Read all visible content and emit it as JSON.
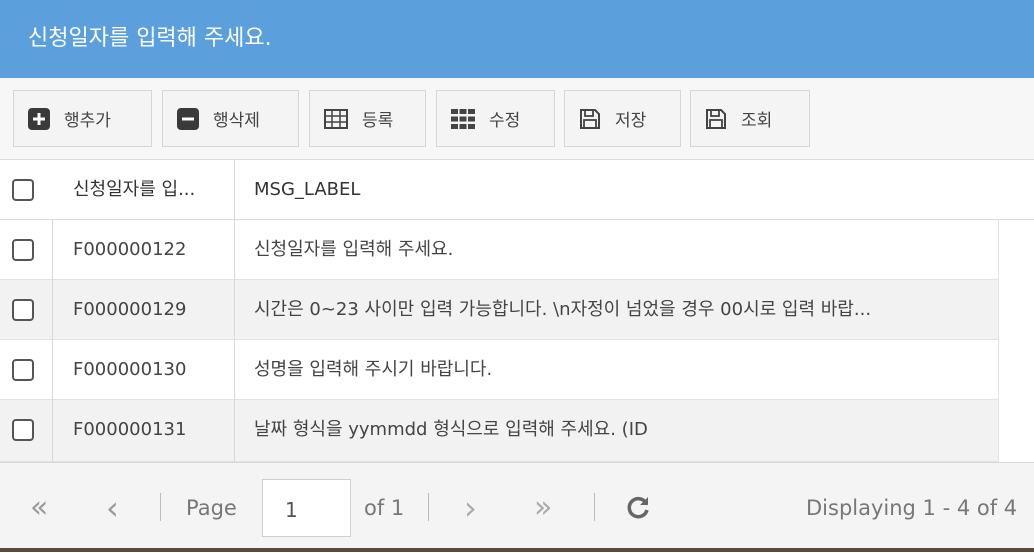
{
  "title": "신청일자를 입력해 주세요.",
  "toolbar": {
    "add_row": "행추가",
    "delete_row": "행삭제",
    "register": "등록",
    "edit": "수정",
    "save": "저장",
    "search": "조회"
  },
  "grid": {
    "columns": [
      "신청일자를 입...",
      "MSG_LABEL"
    ],
    "rows": [
      {
        "id": "F000000122",
        "label": "신청일자를 입력해 주세요."
      },
      {
        "id": "F000000129",
        "label": "시간은 0~23 사이만 입력 가능합니다. \\n자정이 넘었을 경우 00시로 입력 바랍..."
      },
      {
        "id": "F000000130",
        "label": "성명을 입력해 주시기 바랍니다."
      },
      {
        "id": "F000000131",
        "label": "날짜 형식을 yymmdd 형식으로 입력해 주세요. (ID"
      }
    ]
  },
  "pager": {
    "first": "«",
    "prev": "‹",
    "page_label": "Page",
    "page_value": "1",
    "of_label": "of 1",
    "next": "›",
    "last": "»",
    "displaying": "Displaying 1 - 4 of 4"
  },
  "colors": {
    "title_bar": "#5ba0dd",
    "row_alt": "#f2f2f2"
  }
}
